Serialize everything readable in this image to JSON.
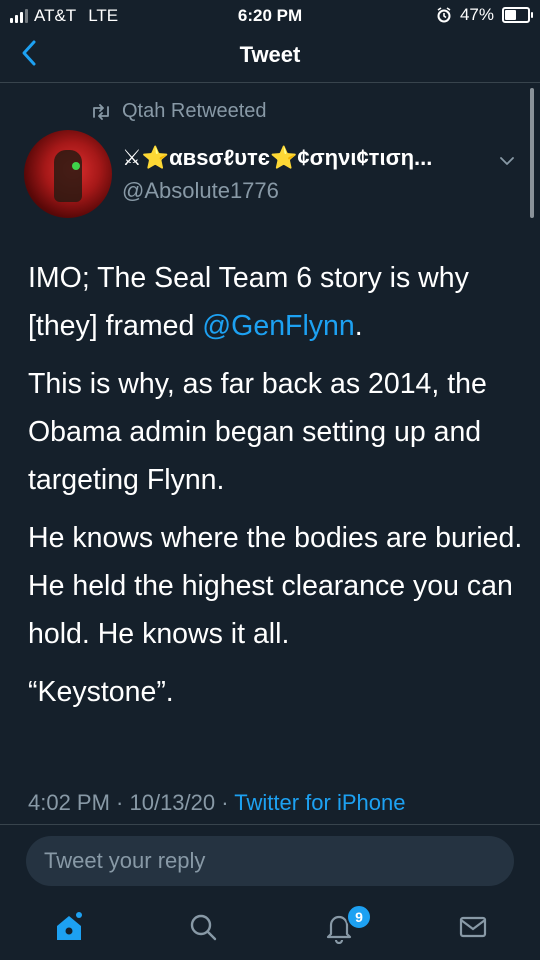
{
  "status_bar": {
    "carrier": "AT&T",
    "network": "LTE",
    "time": "6:20 PM",
    "battery": "47%",
    "battery_level": 0.47
  },
  "nav": {
    "back_icon": "chevron-left-icon",
    "title": "Tweet"
  },
  "retweet": {
    "label": "Qtah Retweeted",
    "icon": "retweet-icon"
  },
  "author": {
    "name_prefix": "⚔",
    "star": "⭐",
    "name_part1": "αвѕσℓυтє",
    "name_part2": "¢σηνι¢тιση...",
    "handle": "@Absolute1776"
  },
  "tweet": {
    "p1_text": "IMO; The Seal Team 6 story is why [they] framed ",
    "p1_mention": "@GenFlynn",
    "p1_end": ".",
    "p2": "This is why, as far back as 2014, the Obama admin began setting up and targeting Flynn.",
    "p3": "He knows where the bodies are buried. He held the highest clearance you can hold. He knows it all.",
    "p4": "“Keystone”."
  },
  "meta": {
    "timestamp": "4:02 PM · 10/13/20 · ",
    "source": "Twitter for iPhone"
  },
  "reply": {
    "placeholder": "Tweet your reply"
  },
  "tabbar": {
    "home_icon": "home-icon",
    "search_icon": "search-icon",
    "notifications_icon": "bell-icon",
    "notifications_count": "9",
    "messages_icon": "mail-icon"
  },
  "colors": {
    "background": "#15202b",
    "accent": "#1da1f2",
    "muted": "#8899a6",
    "divider": "#38444d"
  }
}
